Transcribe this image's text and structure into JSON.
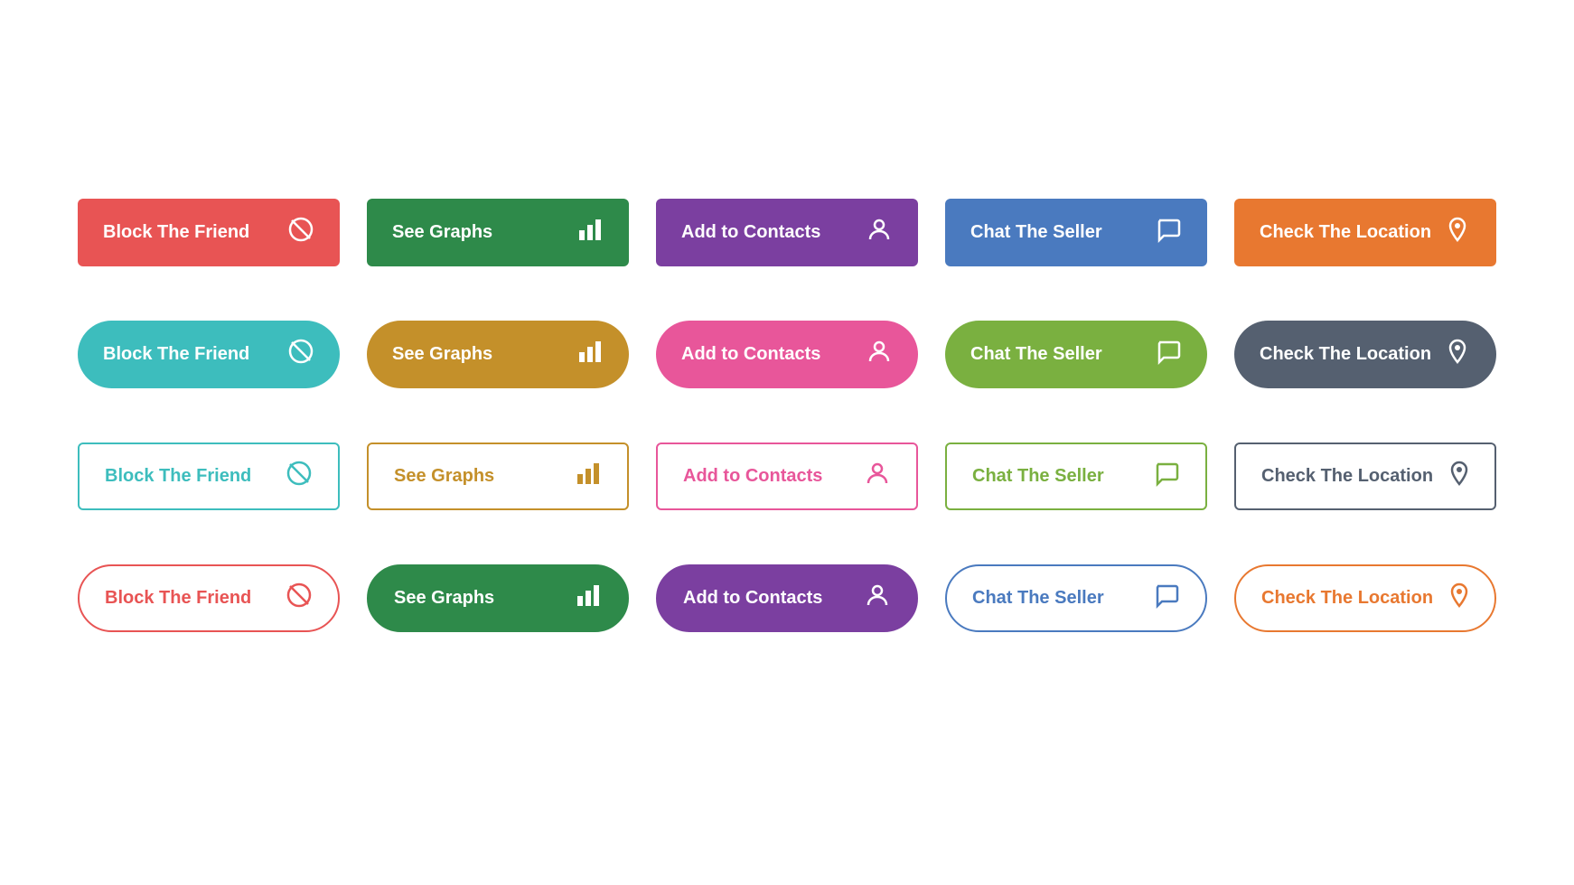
{
  "rows": [
    {
      "id": "row1",
      "style": "solid-sharp",
      "buttons": [
        {
          "id": "block",
          "label": "Block The Friend",
          "icon": "⊘",
          "colorClass": "btn-block"
        },
        {
          "id": "graphs",
          "label": "See Graphs",
          "icon": "📊",
          "colorClass": "btn-graphs"
        },
        {
          "id": "contacts",
          "label": "Add to Contacts",
          "icon": "👤",
          "colorClass": "btn-contacts"
        },
        {
          "id": "seller",
          "label": "Chat The Seller",
          "icon": "💬",
          "colorClass": "btn-seller"
        },
        {
          "id": "location",
          "label": "Check The Location",
          "icon": "📍",
          "colorClass": "btn-location"
        }
      ]
    },
    {
      "id": "row2",
      "style": "solid-pill",
      "buttons": [
        {
          "id": "block",
          "label": "Block The Friend",
          "icon": "⊘",
          "colorClass": "btn-block"
        },
        {
          "id": "graphs",
          "label": "See Graphs",
          "icon": "📊",
          "colorClass": "btn-graphs"
        },
        {
          "id": "contacts",
          "label": "Add to Contacts",
          "icon": "👤",
          "colorClass": "btn-contacts"
        },
        {
          "id": "seller",
          "label": "Chat The Seller",
          "icon": "💬",
          "colorClass": "btn-seller"
        },
        {
          "id": "location",
          "label": "Check The Location",
          "icon": "📍",
          "colorClass": "btn-location"
        }
      ]
    },
    {
      "id": "row3",
      "style": "outline-sharp",
      "buttons": [
        {
          "id": "block",
          "label": "Block The Friend",
          "icon": "⊘",
          "colorClass": "btn-block"
        },
        {
          "id": "graphs",
          "label": "See Graphs",
          "icon": "📊",
          "colorClass": "btn-graphs"
        },
        {
          "id": "contacts",
          "label": "Add to Contacts",
          "icon": "👤",
          "colorClass": "btn-contacts"
        },
        {
          "id": "seller",
          "label": "Chat The Seller",
          "icon": "💬",
          "colorClass": "btn-seller"
        },
        {
          "id": "location",
          "label": "Check The Location",
          "icon": "📍",
          "colorClass": "btn-location"
        }
      ]
    },
    {
      "id": "row4",
      "style": "outline-pill",
      "buttons": [
        {
          "id": "block",
          "label": "Block The Friend",
          "icon": "⊘",
          "colorClass": "btn-block"
        },
        {
          "id": "graphs",
          "label": "See Graphs",
          "icon": "📊",
          "colorClass": "btn-graphs"
        },
        {
          "id": "contacts",
          "label": "Add to Contacts",
          "icon": "👤",
          "colorClass": "btn-contacts"
        },
        {
          "id": "seller",
          "label": "Chat The Seller",
          "icon": "💬",
          "colorClass": "btn-seller"
        },
        {
          "id": "location",
          "label": "Check The Location",
          "icon": "📍",
          "colorClass": "btn-location"
        }
      ]
    }
  ]
}
